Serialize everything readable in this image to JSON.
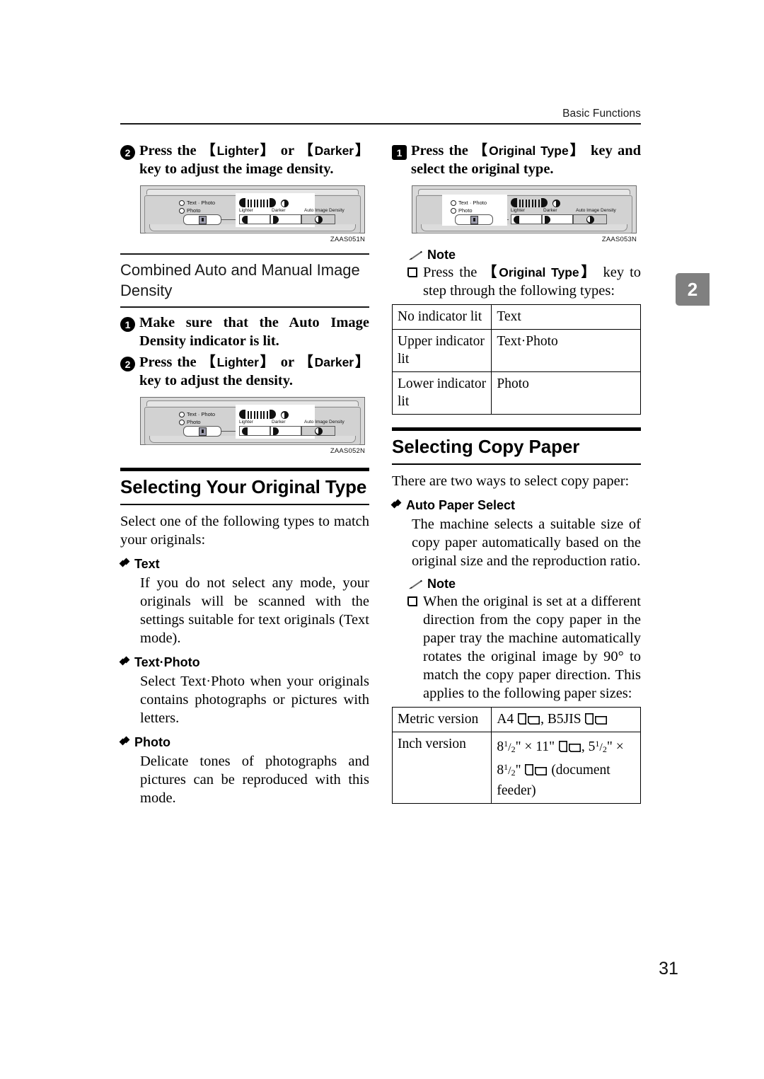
{
  "header": {
    "title": "Basic Functions"
  },
  "chapter_tab": {
    "number": "2"
  },
  "page_number": "31",
  "left_column": {
    "step2_density": {
      "badge": "2",
      "text_parts": {
        "a": "Press the ",
        "key1": "Lighter",
        "b": " or ",
        "key2": "Darker",
        "c": " key to adjust the image density."
      }
    },
    "figure1": {
      "id": "ZAAS051N",
      "radio1": "Text · Photo",
      "radio2": "Photo",
      "label_lighter": "Lighter",
      "label_darker": "Darker",
      "label_auto": "Auto Image Density"
    },
    "subheading": "Combined Auto and Manual Image Density",
    "step1_combined": {
      "badge": "1",
      "text": "Make sure that the Auto Image Density indicator is lit."
    },
    "step2_combined": {
      "badge": "2",
      "text_parts": {
        "a": "Press the ",
        "key1": "Lighter",
        "b": " or ",
        "key2": "Darker",
        "c": " key to adjust the density."
      }
    },
    "figure2": {
      "id": "ZAAS052N",
      "radio1": "Text · Photo",
      "radio2": "Photo",
      "label_lighter": "Lighter",
      "label_darker": "Darker",
      "label_auto": "Auto Image Density"
    },
    "section_heading": "Selecting Your Original Type",
    "intro": "Select one of the following types to match your originals:",
    "bullets": [
      {
        "title": "Text",
        "body": "If you do not select any mode, your originals will be scanned with the settings suitable for text originals (Text mode)."
      },
      {
        "title": "Text·Photo",
        "body": "Select Text·Photo when your originals contains photographs or pictures with letters."
      },
      {
        "title": "Photo",
        "body": "Delicate tones of photographs and pictures can be reproduced with this mode."
      }
    ]
  },
  "right_column": {
    "step1_origtype": {
      "badge": "1",
      "text_parts": {
        "a": "Press the ",
        "key1": "Original Type",
        "b": " key and select the original type."
      }
    },
    "figure3": {
      "id": "ZAAS053N",
      "radio1": "Text · Photo",
      "radio2": "Photo",
      "label_lighter": "Lighter",
      "label_darker": "Darker",
      "label_auto": "Auto Image Density"
    },
    "note1": {
      "label": "Note",
      "text_parts": {
        "a": "Press the ",
        "key1": "Original Type",
        "b": " key to step through the following types:"
      }
    },
    "indicator_table": {
      "rows": [
        {
          "c1": "No indicator lit",
          "c2": "Text"
        },
        {
          "c1": "Upper indicator lit",
          "c2": "Text·Photo"
        },
        {
          "c1": "Lower indicator lit",
          "c2": "Photo"
        }
      ]
    },
    "section_heading": "Selecting Copy Paper",
    "intro": "There are two ways to select copy paper:",
    "bullet_auto": {
      "title": "Auto Paper Select",
      "body": "The machine selects a suitable size of copy paper automatically based on the original size and the reproduction ratio."
    },
    "note2": {
      "label": "Note",
      "text": "When the original is set at a different direction from the copy paper in the paper tray the machine automatically rotates the original image by 90° to match the copy paper direction. This applies to the following paper sizes:"
    },
    "size_table": {
      "rows": [
        {
          "c1": "Metric version",
          "parts": {
            "a": "A4 ",
            "b": ", B5JIS ",
            "c": ""
          }
        },
        {
          "c1": "Inch version",
          "parts": {
            "a": "8",
            "num": "1",
            "den": "2",
            "unit": "\" × 11\" ",
            "b": ", 5",
            "num2": "1",
            "den2": "2",
            "unit2": "\" × 8",
            "num3": "1",
            "den3": "2",
            "unit3": "\" ",
            "c": " (document feeder)"
          }
        }
      ]
    }
  }
}
